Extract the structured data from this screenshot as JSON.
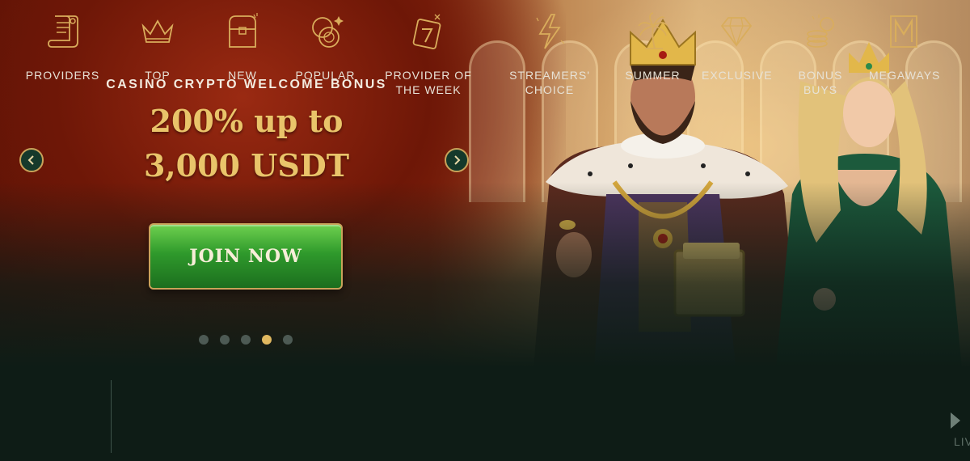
{
  "hero": {
    "kicker": "CASINO CRYPTO WELCOME BONUS",
    "headline_line1": "200% up to",
    "headline_line2": "3,000 USDT",
    "cta_label": "JOIN NOW",
    "slides_total": 5,
    "active_slide": 4
  },
  "categories": [
    {
      "label": "PROVIDERS",
      "icon": "scroll-icon"
    },
    {
      "label": "TOP",
      "icon": "crown-icon"
    },
    {
      "label": "NEW",
      "icon": "treasure-chest-icon"
    },
    {
      "label": "POPULAR",
      "icon": "coins-icon"
    },
    {
      "label": "PROVIDER OF THE WEEK",
      "icon": "calendar-seven-icon"
    },
    {
      "label": "STREAMERS' CHOICE",
      "icon": "lightning-icon"
    },
    {
      "label": "SUMMER",
      "icon": "palm-tree-icon"
    },
    {
      "label": "EXCLUSIVE",
      "icon": "diamond-icon"
    },
    {
      "label": "BONUS BUYS",
      "icon": "coin-stack-icon"
    },
    {
      "label": "MEGAWAYS",
      "icon": "megaways-m-icon"
    }
  ],
  "more_label": "LIV",
  "colors": {
    "gold": "#e9c46a",
    "cta_green": "#2f9a2c",
    "background": "#0e1c16",
    "dot_inactive": "#4d5a54",
    "dot_active": "#e0b860"
  }
}
